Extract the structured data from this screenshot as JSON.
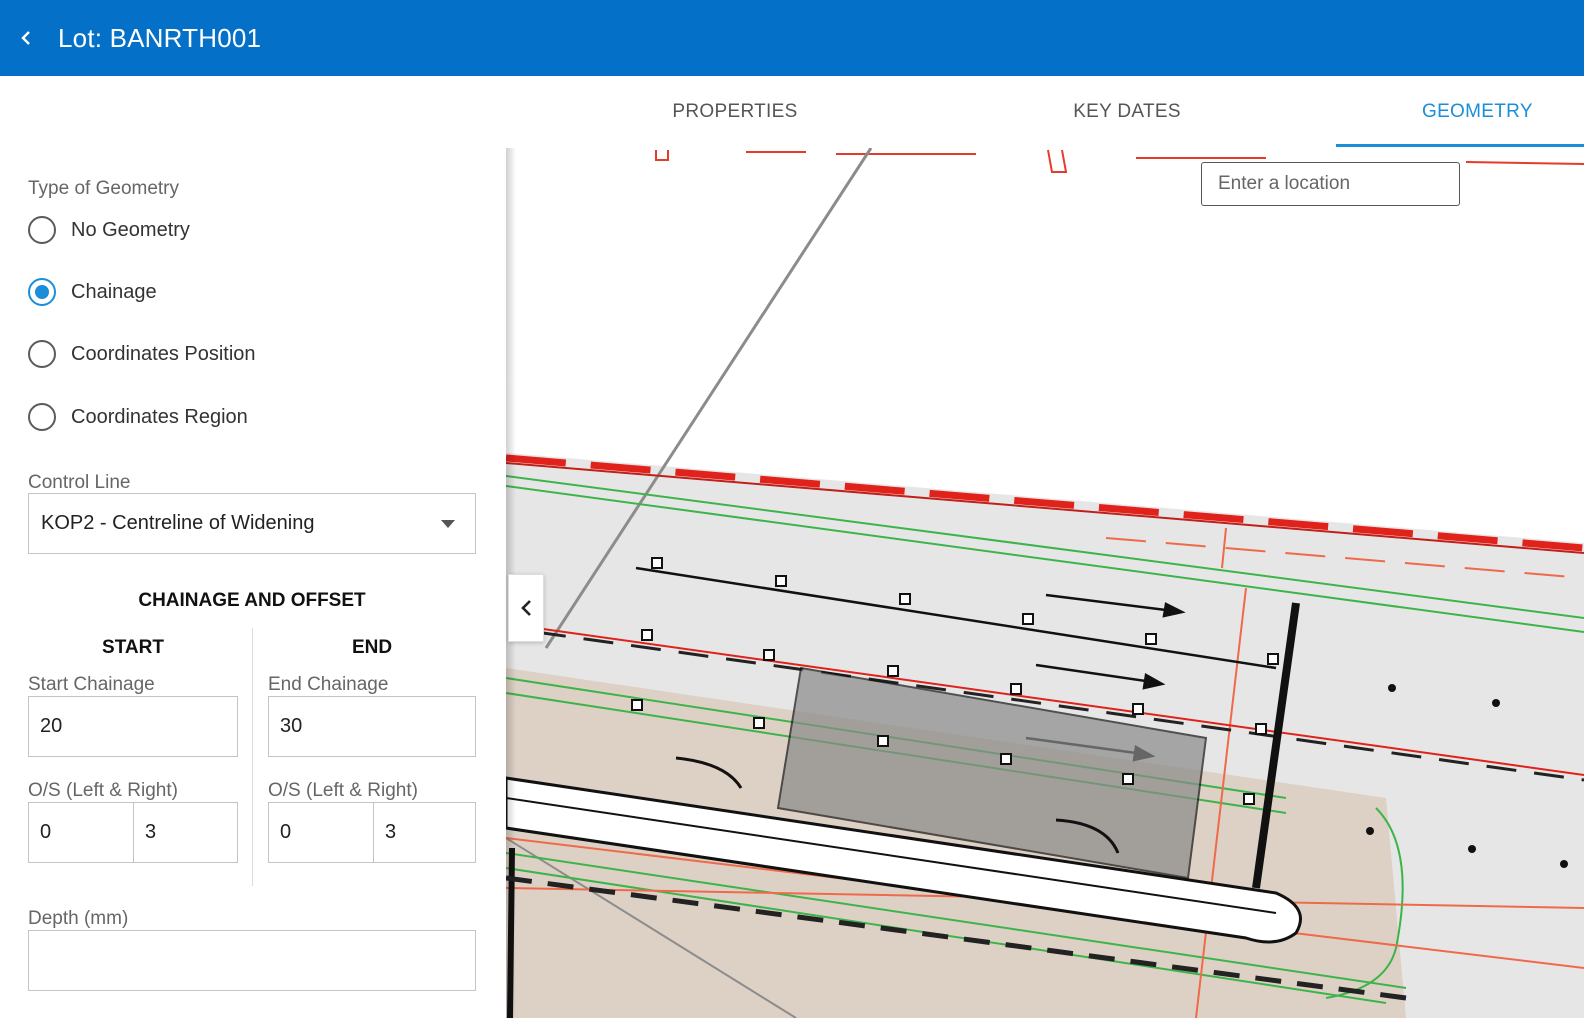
{
  "header": {
    "title": "Lot: BANRTH001",
    "back_icon": "chevron-left-icon",
    "bar_color": "#0570c7"
  },
  "tabs": [
    {
      "label": "PROPERTIES",
      "active": false
    },
    {
      "label": "KEY DATES",
      "active": false
    },
    {
      "label": "GEOMETRY",
      "active": true
    }
  ],
  "accent_color": "#1a8fd8",
  "geometry": {
    "type_label": "Type of Geometry",
    "options": [
      {
        "label": "No Geometry",
        "selected": false
      },
      {
        "label": "Chainage",
        "selected": true
      },
      {
        "label": "Coordinates Position",
        "selected": false
      },
      {
        "label": "Coordinates Region",
        "selected": false
      }
    ],
    "control_line_label": "Control Line",
    "control_line_value": "KOP2 - Centreline of Widening",
    "section_title": "CHAINAGE AND OFFSET",
    "start": {
      "heading": "START",
      "chainage_label": "Start Chainage",
      "chainage_value": "20",
      "offset_label": "O/S (Left & Right)",
      "offset_left": "0",
      "offset_right": "3"
    },
    "end": {
      "heading": "END",
      "chainage_label": "End Chainage",
      "chainage_value": "30",
      "offset_label": "O/S (Left & Right)",
      "offset_left": "0",
      "offset_right": "3"
    },
    "depth_label": "Depth (mm)",
    "depth_value": ""
  },
  "map": {
    "search_placeholder": "Enter a location",
    "collapse_icon": "chevron-left-icon"
  }
}
